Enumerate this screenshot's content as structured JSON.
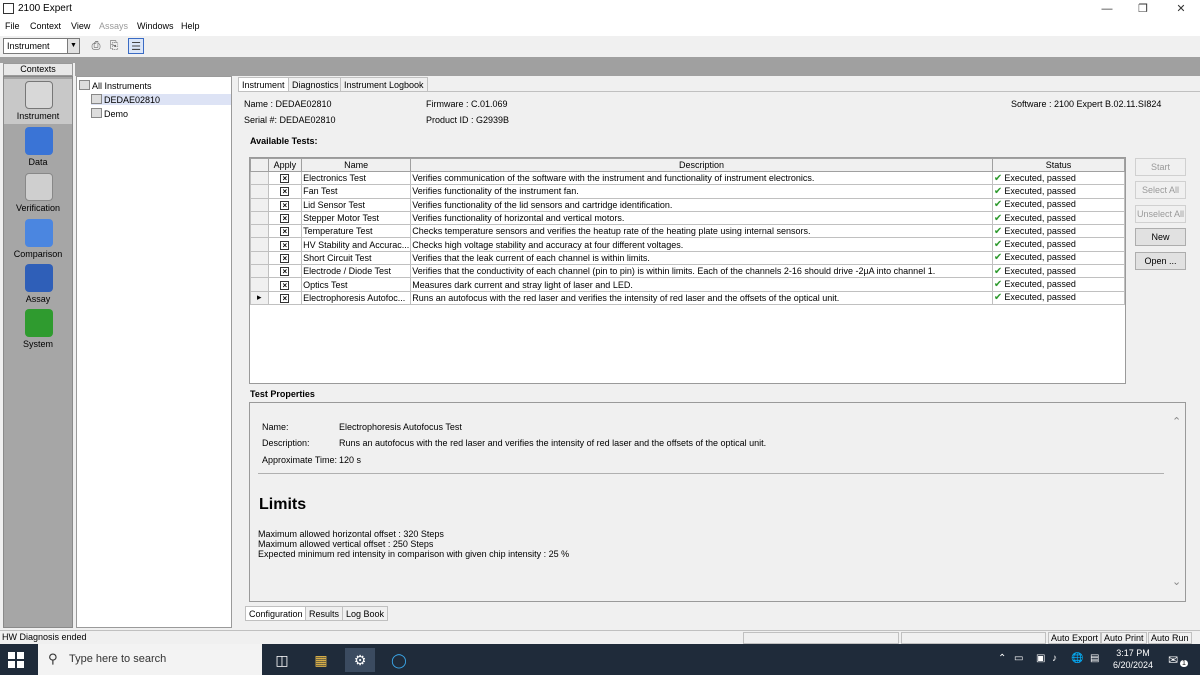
{
  "window": {
    "title": "2100 Expert"
  },
  "menu": [
    "File",
    "Context",
    "View",
    "Assays",
    "Windows",
    "Help"
  ],
  "toolbar": {
    "combo_value": "Instrument"
  },
  "contexts": {
    "header": "Contexts",
    "items": [
      {
        "label": "Instrument",
        "icon": "instrument-icon"
      },
      {
        "label": "Data",
        "icon": "data-icon"
      },
      {
        "label": "Verification",
        "icon": "verification-icon"
      },
      {
        "label": "Comparison",
        "icon": "comparison-icon"
      },
      {
        "label": "Assay",
        "icon": "assay-icon"
      },
      {
        "label": "System",
        "icon": "system-icon"
      }
    ]
  },
  "tree": {
    "root": "All Instruments",
    "children": [
      "DEDAE02810",
      "Demo"
    ]
  },
  "tabs": [
    "Instrument",
    "Diagnostics",
    "Instrument Logbook"
  ],
  "instrument_info": {
    "name": "Name : DEDAE02810",
    "serial": "Serial #: DEDAE02810",
    "firmware": "Firmware : C.01.069",
    "product_id": "Product ID : G2939B",
    "software": "Software : 2100 Expert B.02.11.SI824"
  },
  "available_tests_label": "Available Tests:",
  "table": {
    "headers": [
      "Apply",
      "Name",
      "Description",
      "Status"
    ],
    "rows": [
      {
        "name": "Electronics Test",
        "description": "Verifies communication of the software with the instrument and functionality of instrument electronics.",
        "status": "Executed, passed"
      },
      {
        "name": "Fan Test",
        "description": "Verifies functionality of the instrument fan.",
        "status": "Executed, passed"
      },
      {
        "name": "Lid Sensor Test",
        "description": "Verifies functionality of the lid sensors and cartridge identification.",
        "status": "Executed, passed"
      },
      {
        "name": "Stepper Motor Test",
        "description": "Verifies functionality of horizontal and vertical motors.",
        "status": "Executed, passed"
      },
      {
        "name": "Temperature Test",
        "description": "Checks temperature sensors and verifies the heatup rate of the heating plate using internal sensors.",
        "status": "Executed, passed"
      },
      {
        "name": "HV Stability and Accurac...",
        "description": "Checks high voltage stability and accuracy at four different voltages.",
        "status": "Executed, passed"
      },
      {
        "name": "Short Circuit Test",
        "description": "Verifies that the leak current of each channel is within limits.",
        "status": "Executed, passed"
      },
      {
        "name": "Electrode / Diode Test",
        "description": "Verifies that the conductivity of each  channel (pin to pin) is within limits. Each of the channels 2-16 should drive -2µA into channel 1.",
        "status": "Executed, passed"
      },
      {
        "name": "Optics Test",
        "description": "Measures dark current and stray light of laser and LED.",
        "status": "Executed, passed"
      },
      {
        "name": "Electrophoresis Autofoc...",
        "description": "Runs an autofocus with the red laser and verifies the intensity of red laser and the offsets of the optical unit.",
        "status": "Executed, passed"
      }
    ]
  },
  "buttons": {
    "start": "Start",
    "select_all": "Select All",
    "unselect_all": "Unselect All",
    "new": "New",
    "open": "Open ..."
  },
  "test_properties": {
    "label": "Test Properties",
    "name_label": "Name:",
    "name_value": "Electrophoresis Autofocus Test",
    "desc_label": "Description:",
    "desc_value": "Runs an autofocus with the red laser and verifies the intensity of red laser and the offsets of the optical unit.",
    "time_label": "Approximate Time:",
    "time_value": "120 s",
    "limits_title": "Limits",
    "limits": [
      "Maximum allowed horizontal offset :  320  Steps",
      "Maximum allowed vertical offset :  250  Steps",
      "Expected minimum red intensity in comparison with given chip intensity :  25  %"
    ]
  },
  "bottom_tabs": [
    "Configuration",
    "Results",
    "Log Book"
  ],
  "status": {
    "message": "HW Diagnosis ended",
    "auto_export": "Auto Export",
    "auto_print": "Auto Print",
    "auto_run": "Auto Run"
  },
  "taskbar": {
    "search_placeholder": "Type here to search",
    "time": "3:17 PM",
    "date": "6/20/2024",
    "notification_count": "1"
  }
}
